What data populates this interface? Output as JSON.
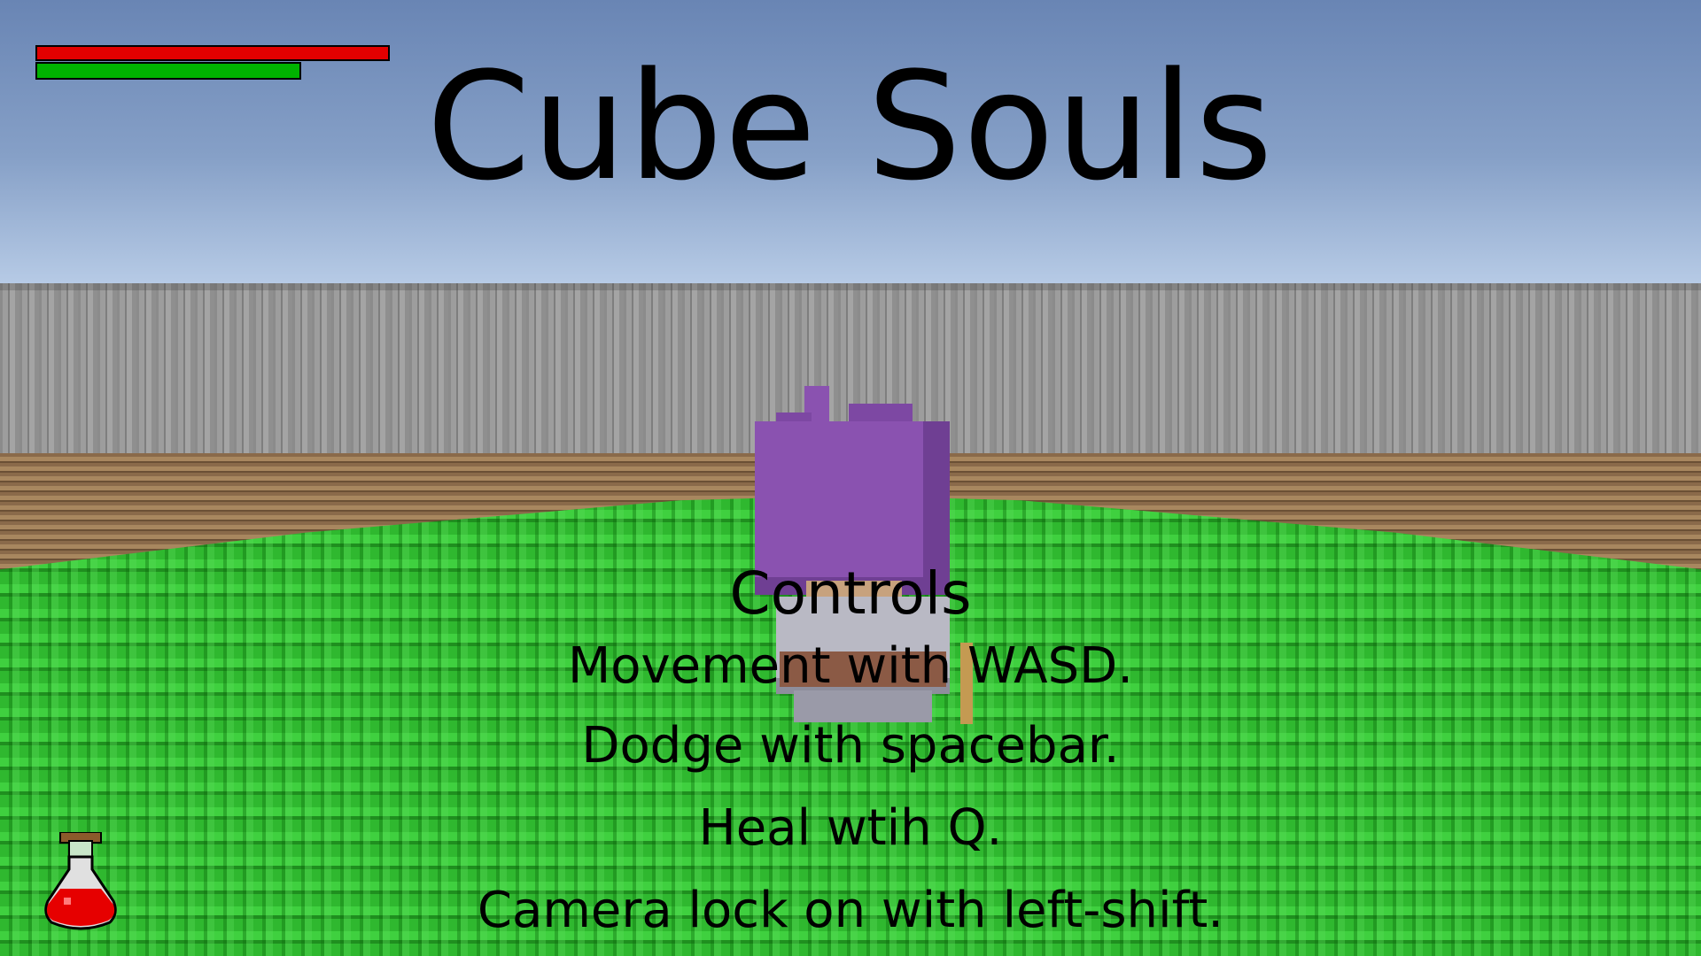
{
  "game": {
    "title": "Cube Souls"
  },
  "hud": {
    "health": {
      "fraction": 1.0,
      "color": "#e30000"
    },
    "stamina": {
      "fraction": 1.0,
      "color": "#00b300"
    },
    "potion_icon": "red-potion-icon"
  },
  "controls": {
    "heading": "Controls",
    "lines": [
      "Movement with WASD.",
      "Dodge with spacebar.",
      "Heal wtih Q.",
      "Camera lock on with left-shift."
    ]
  }
}
